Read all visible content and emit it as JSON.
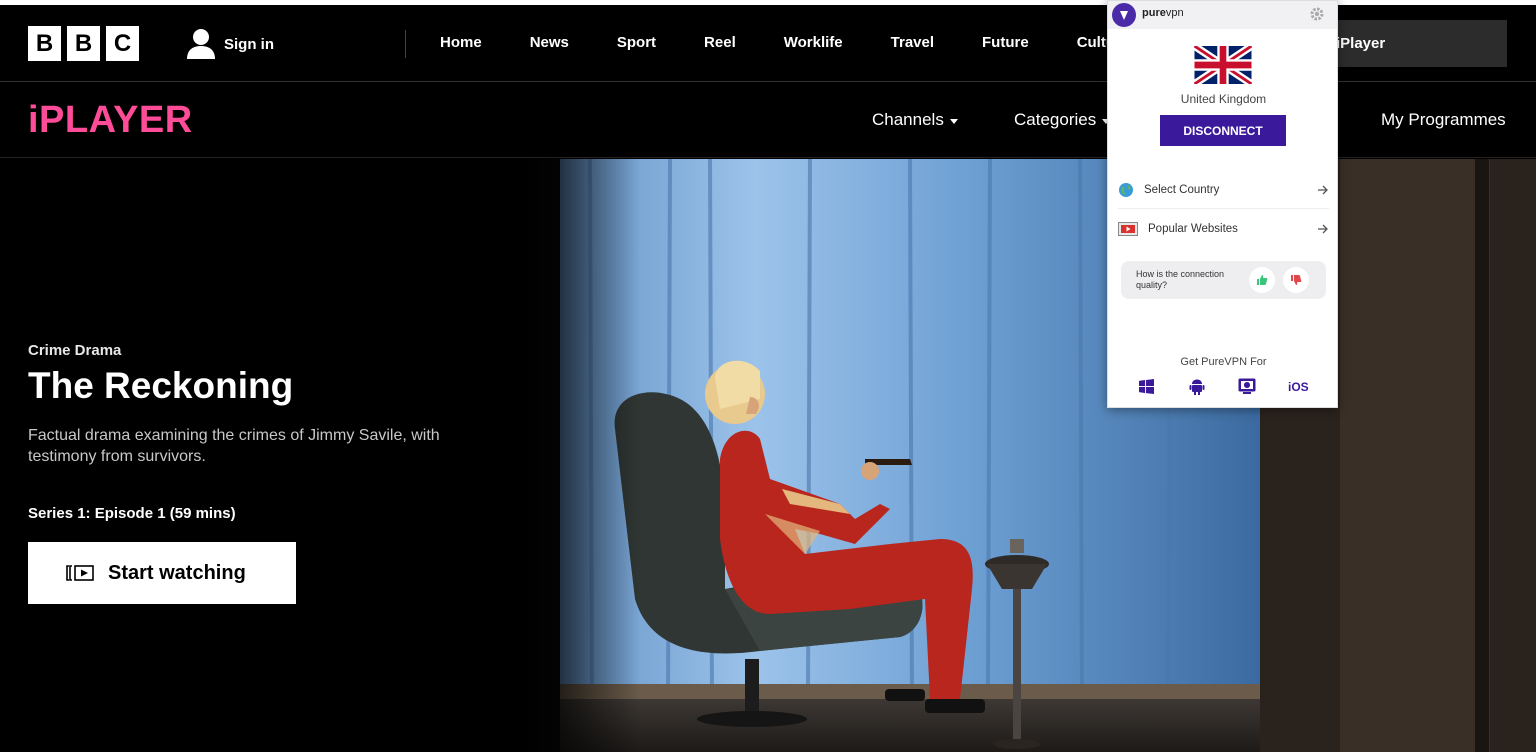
{
  "masthead": {
    "logo": [
      "B",
      "B",
      "C"
    ],
    "sign_in": "Sign in",
    "nav": [
      "Home",
      "News",
      "Sport",
      "Reel",
      "Worklife",
      "Travel",
      "Future",
      "Culture"
    ],
    "search_label": "iPlayer"
  },
  "iplayer": {
    "logo": "iPLAYER",
    "channels": "Channels",
    "categories": "Categories",
    "my_programmes": "My Programmes",
    "accent": "#ff4c98"
  },
  "hero": {
    "genre": "Crime Drama",
    "title": "The Reckoning",
    "description": "Factual drama examining the crimes of Jimmy Savile, with testimony from survivors.",
    "episode": "Series 1: Episode 1 (59 mins)",
    "cta": "Start watching",
    "cta_icon": "play-icon"
  },
  "vpn": {
    "brand_bold": "pure",
    "brand_light": "vpn",
    "country": "United Kingdom",
    "disconnect": "DISCONNECT",
    "select_country": "Select Country",
    "popular_websites": "Popular Websites",
    "quality_question": "How is the connection quality?",
    "get_for": "Get PureVPN For",
    "ios": "iOS",
    "accent": "#3a1a9b"
  }
}
